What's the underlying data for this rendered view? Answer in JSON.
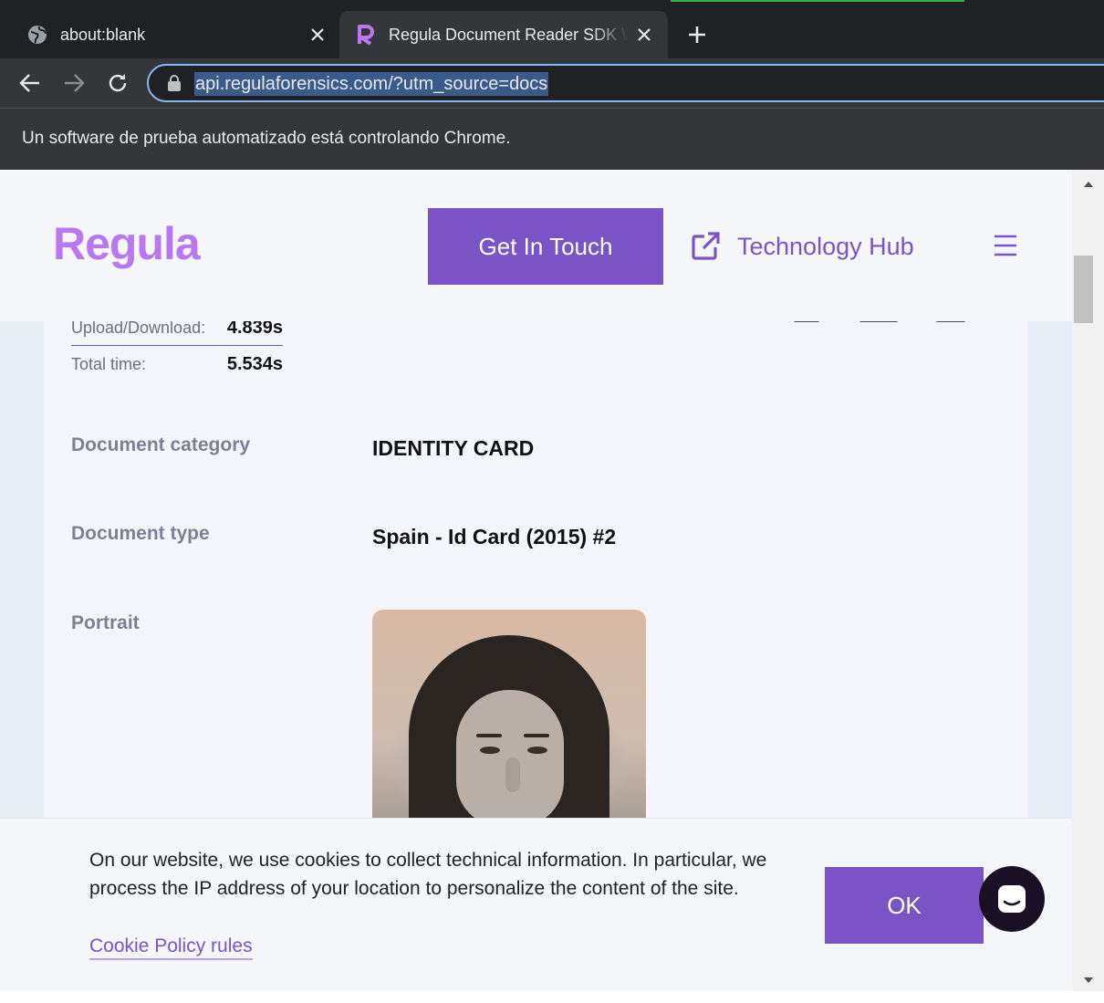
{
  "tabs": [
    {
      "title": "about:blank",
      "icon": "globe-icon"
    },
    {
      "title": "Regula Document Reader SDK Web API",
      "icon": "regula-favicon-icon"
    }
  ],
  "toolbar": {
    "url": "api.regulaforensics.com/?utm_source=docs"
  },
  "infobar": {
    "text": "Un software de prueba automatizado está controlando Chrome."
  },
  "header": {
    "logo": "Regula",
    "get_in_touch": "Get In Touch",
    "tech_hub": "Technology Hub"
  },
  "timing": [
    {
      "label": "Upload/Download:",
      "value": "4.839s"
    },
    {
      "label": "Total time:",
      "value": "5.534s"
    }
  ],
  "fields": {
    "category_label": "Document category",
    "category_value": "IDENTITY CARD",
    "type_label": "Document type",
    "type_value": "Spain - Id Card (2015) #2",
    "portrait_label": "Portrait"
  },
  "cookie": {
    "text": "On our website, we use cookies to collect technical information. In particular, we process the IP address of your location to personalize the content of the site.",
    "link": "Cookie Policy rules",
    "ok": "OK"
  },
  "colors": {
    "brand": "#7a54c6",
    "logo": "#b978f2",
    "chrome_dark": "#202124",
    "chrome_toolbar": "#35363a"
  }
}
